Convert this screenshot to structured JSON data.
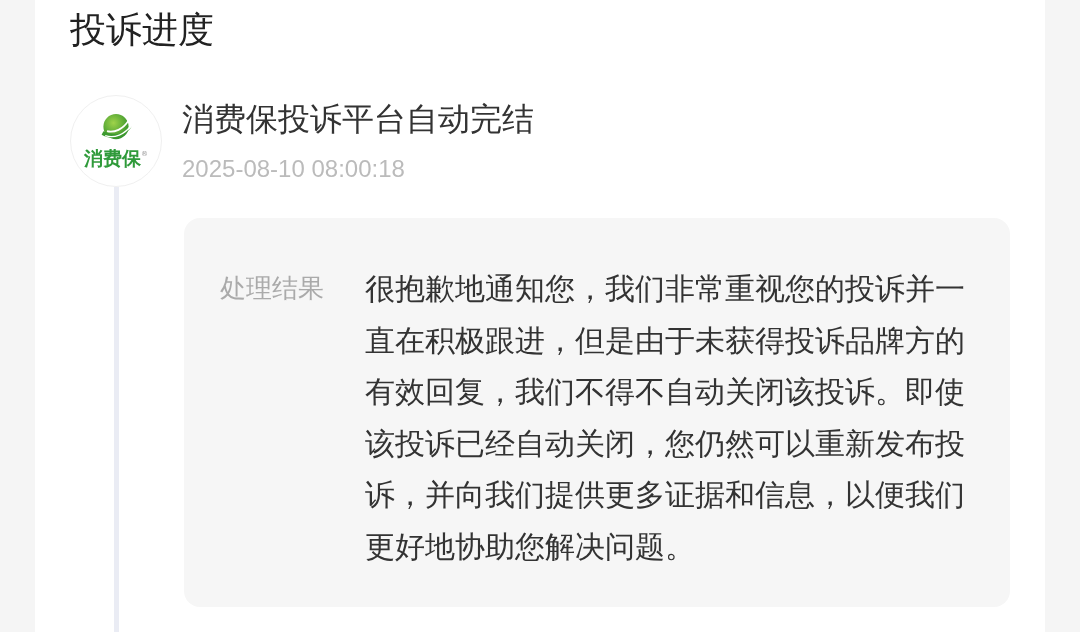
{
  "page": {
    "title": "投诉进度"
  },
  "timeline": [
    {
      "logo_text": "消费保$^{®}$",
      "title": "消费保投诉平台自动完结",
      "time": "2025-08-10 08:00:18",
      "details": [
        {
          "label": "处理结果",
          "text": "很抱歉地通知您，我们非常重视您的投诉并一直在积极跟进，但是由于未获得投诉品牌方的有效回复，我们不得不自动关闭该投诉。即使该投诉已经自动关闭，您仍然可以重新发布投诉，并向我们提供更多证据和信息，以便我们更好地协助您解决问题。"
        }
      ]
    }
  ]
}
